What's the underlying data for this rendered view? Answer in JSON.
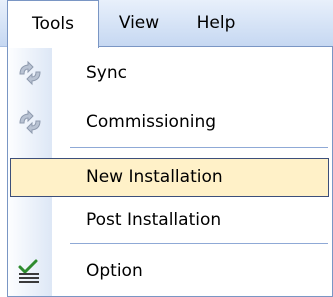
{
  "menubar": {
    "items": [
      {
        "label": "Tools",
        "active": true
      },
      {
        "label": "View"
      },
      {
        "label": "Help"
      }
    ]
  },
  "dropdown": {
    "items": [
      {
        "label": "Sync",
        "icon": "sync-icon",
        "disabled_icon": true
      },
      {
        "label": "Commissioning",
        "icon": "sync-icon",
        "disabled_icon": true
      },
      {
        "label": "New Installation",
        "highlighted": true
      },
      {
        "label": "Post Installation"
      },
      {
        "label": "Option",
        "icon": "checklist-icon"
      }
    ]
  },
  "colors": {
    "menubar_top": "#e8f0fb",
    "menubar_bottom": "#c6d8f2",
    "highlight_fill": "#fff1c8",
    "highlight_border": "#3d4f7a",
    "separator": "#8fa9d6",
    "check_green": "#2e8b2e"
  }
}
